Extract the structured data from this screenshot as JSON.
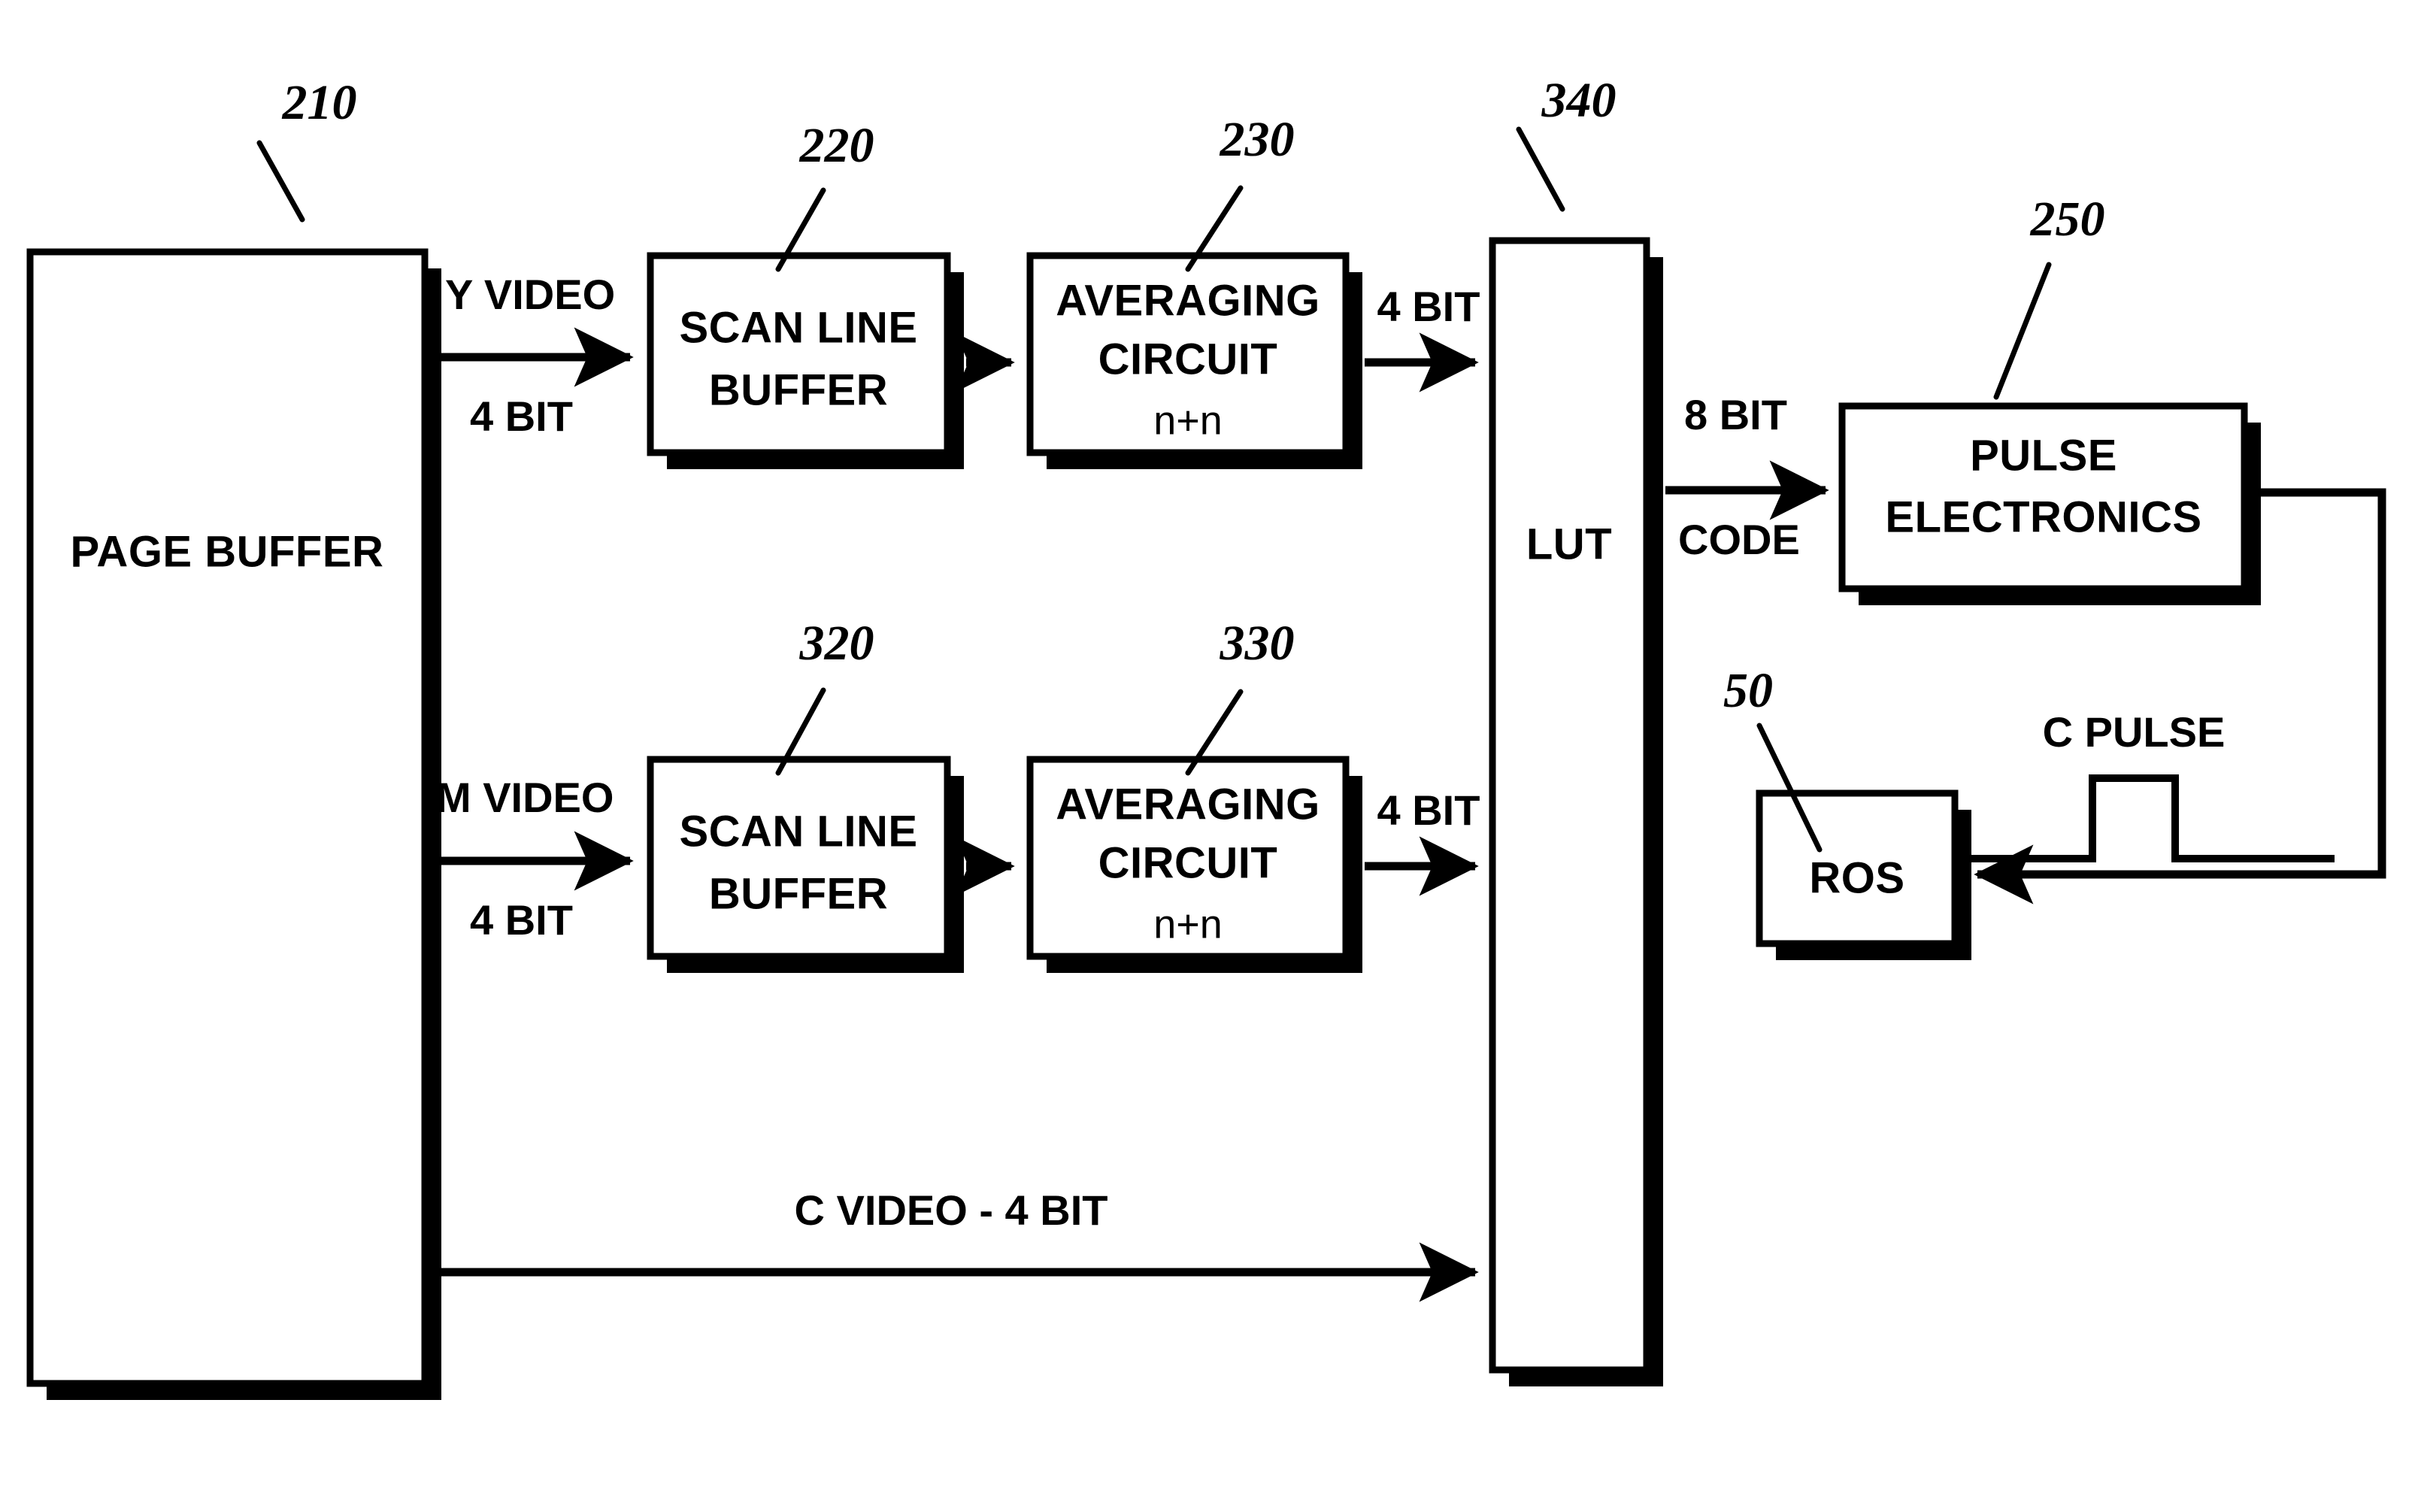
{
  "figure": {
    "kind": "patent-block-diagram",
    "ink_color": "#000000",
    "background_color": "#ffffff"
  },
  "blocks": {
    "page_buffer": {
      "label": "PAGE BUFFER",
      "ref": "210"
    },
    "scan_buffer_y": {
      "label_line1": "SCAN LINE",
      "label_line2": "BUFFER",
      "ref": "220"
    },
    "averaging_y": {
      "label_line1": "AVERAGING",
      "label_line2": "CIRCUIT",
      "label_line3": "n+n",
      "ref": "230"
    },
    "scan_buffer_m": {
      "label_line1": "SCAN LINE",
      "label_line2": "BUFFER",
      "ref": "320"
    },
    "averaging_m": {
      "label_line1": "AVERAGING",
      "label_line2": "CIRCUIT",
      "label_line3": "n+n",
      "ref": "330"
    },
    "lut": {
      "label": "LUT",
      "ref": "340"
    },
    "pulse_electronics": {
      "label_line1": "PULSE",
      "label_line2": "ELECTRONICS",
      "ref": "250"
    },
    "ros": {
      "label": "ROS",
      "ref": "50"
    }
  },
  "wire_labels": {
    "y_video": "Y VIDEO",
    "y_video_bits": "4 BIT",
    "m_video": "M VIDEO",
    "m_video_bits": "4 BIT",
    "avg_y_out_bits": "4 BIT",
    "avg_m_out_bits": "4 BIT",
    "c_video": "C VIDEO - 4 BIT",
    "lut_out_bits": "8  BIT",
    "lut_out_code": "CODE",
    "c_pulse": "C PULSE"
  },
  "signal_flow": {
    "description": "Page buffer feeds Y and M video paths through scan line buffers and averaging circuits into the LUT; C video bypasses directly to the LUT; the LUT 8 bit code drives pulse electronics which feeds back a C pulse to the ROS.",
    "paths": [
      "PAGE BUFFER -> Y VIDEO 4 BIT -> SCAN LINE BUFFER 220 -> AVERAGING CIRCUIT 230 -> 4 BIT -> LUT 340",
      "PAGE BUFFER -> M VIDEO 4 BIT -> SCAN LINE BUFFER 320 -> AVERAGING CIRCUIT 330 -> 4 BIT -> LUT 340",
      "PAGE BUFFER -> C VIDEO - 4 BIT -> LUT 340",
      "LUT 340 -> 8 BIT CODE -> PULSE ELECTRONICS 250",
      "PULSE ELECTRONICS 250 -> C PULSE -> ROS 50"
    ]
  }
}
